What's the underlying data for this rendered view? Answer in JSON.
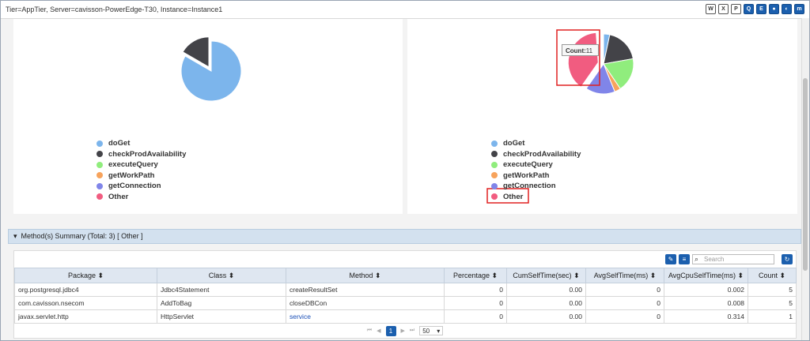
{
  "header": {
    "breadcrumb": "Tier=AppTier, Server=cavisson-PowerEdge-T30, Instance=Instance1",
    "tools": [
      {
        "name": "word-export-icon",
        "glyph": "W",
        "style": "doc"
      },
      {
        "name": "excel-export-icon",
        "glyph": "X",
        "style": "doc"
      },
      {
        "name": "pdf-export-icon",
        "glyph": "P",
        "style": "doc"
      },
      {
        "name": "zoom-icon",
        "glyph": "Q",
        "style": "blue"
      },
      {
        "name": "info-icon",
        "glyph": "E",
        "style": "blue"
      },
      {
        "name": "settings-icon",
        "glyph": "●",
        "style": "blue"
      },
      {
        "name": "toggle-icon",
        "glyph": "◐",
        "style": "blue"
      },
      {
        "name": "menu-icon",
        "glyph": "m",
        "style": "blue"
      }
    ]
  },
  "legend": [
    {
      "label": "doGet",
      "color": "#7cb5ec"
    },
    {
      "label": "checkProdAvailability",
      "color": "#434348"
    },
    {
      "label": "executeQuery",
      "color": "#90ed7d"
    },
    {
      "label": "getWorkPath",
      "color": "#f7a35c"
    },
    {
      "label": "getConnection",
      "color": "#8085e9"
    },
    {
      "label": "Other",
      "color": "#f15c80"
    }
  ],
  "tooltip": {
    "label": "Count:",
    "value": "11"
  },
  "summary": {
    "title": "Method(s) Summary (Total: 3) [ Other ]"
  },
  "table": {
    "search_placeholder": "Search",
    "columns": [
      "Package",
      "Class",
      "Method",
      "Percentage",
      "CumSelfTime(sec)",
      "AvgSelfTime(ms)",
      "AvgCpuSelfTime(ms)",
      "Count"
    ],
    "rows": [
      [
        "org.postgresql.jdbc4",
        "Jdbc4Statement",
        "createResultSet",
        "0",
        "0.00",
        "0",
        "0.002",
        "5"
      ],
      [
        "com.cavisson.nsecom",
        "AddToBag",
        "closeDBCon",
        "0",
        "0.00",
        "0",
        "0.008",
        "5"
      ],
      [
        "javax.servlet.http",
        "HttpServlet",
        "service",
        "0",
        "0.00",
        "0",
        "0.314",
        "1"
      ]
    ]
  },
  "pager": {
    "current_page": "1",
    "page_size": "50"
  }
}
